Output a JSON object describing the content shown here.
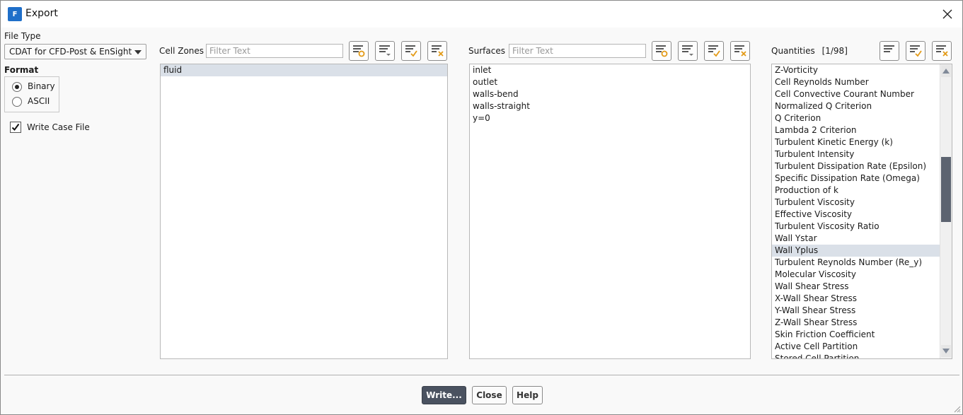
{
  "window": {
    "title": "Export",
    "app_icon_letter": "F"
  },
  "left": {
    "file_type_label": "File Type",
    "file_type_value": "CDAT for CFD-Post & EnSight",
    "format_label": "Format",
    "format_options": [
      "Binary",
      "ASCII"
    ],
    "format_selected": "Binary",
    "write_case_file_label": "Write Case File",
    "write_case_file_checked": true
  },
  "cell_zones": {
    "label": "Cell Zones",
    "filter_placeholder": "Filter Text",
    "items": [
      "fluid"
    ],
    "selected": "fluid"
  },
  "surfaces": {
    "label": "Surfaces",
    "filter_placeholder": "Filter Text",
    "items": [
      "inlet",
      "outlet",
      "walls-bend",
      "walls-straight",
      "y=0"
    ]
  },
  "quantities": {
    "label": "Quantities",
    "count": "[1/98]",
    "items": [
      "Z-Vorticity",
      "Cell Reynolds Number",
      "Cell Convective Courant Number",
      "Normalized Q Criterion",
      "Q Criterion",
      "Lambda 2 Criterion",
      "Turbulent Kinetic Energy (k)",
      "Turbulent Intensity",
      "Turbulent Dissipation Rate (Epsilon)",
      "Specific Dissipation Rate (Omega)",
      "Production of k",
      "Turbulent Viscosity",
      "Effective Viscosity",
      "Turbulent Viscosity Ratio",
      "Wall Ystar",
      "Wall Yplus",
      "Turbulent Reynolds Number (Re_y)",
      "Molecular Viscosity",
      "Wall Shear Stress",
      "X-Wall Shear Stress",
      "Y-Wall Shear Stress",
      "Z-Wall Shear Stress",
      "Skin Friction Coefficient",
      "Active Cell Partition",
      "Stored Cell Partition"
    ],
    "selected": "Wall Yplus"
  },
  "footer": {
    "write_label": "Write...",
    "close_label": "Close",
    "help_label": "Help"
  },
  "colors": {
    "selection": "#dae0e8",
    "primary_button": "#4a5260",
    "scroll_thumb": "#5c6370"
  }
}
